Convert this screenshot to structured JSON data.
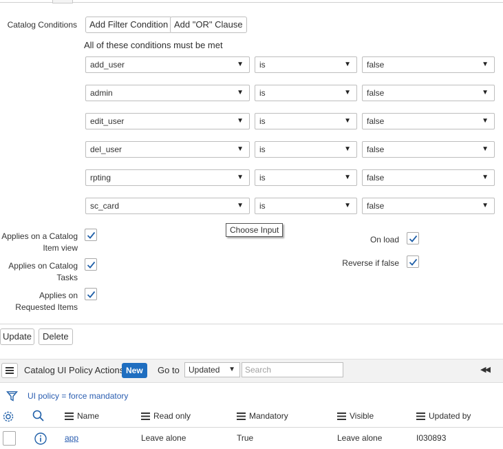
{
  "conditions": {
    "label": "Catalog Conditions",
    "add_filter": "Add Filter Condition",
    "add_or": "Add \"OR\" Clause",
    "heading": "All of these conditions must be met",
    "rows": [
      {
        "field": "add_user",
        "operator": "is",
        "value": "false"
      },
      {
        "field": "admin",
        "operator": "is",
        "value": "false"
      },
      {
        "field": "edit_user",
        "operator": "is",
        "value": "false"
      },
      {
        "field": "del_user",
        "operator": "is",
        "value": "false"
      },
      {
        "field": "rpting",
        "operator": "is",
        "value": "false"
      },
      {
        "field": "sc_card",
        "operator": "is",
        "value": "false"
      }
    ],
    "tooltip": "Choose Input"
  },
  "options": {
    "applies_catalog_item_line1": "Applies on a Catalog",
    "applies_catalog_item_line2": "Item view",
    "applies_catalog_tasks_line1": "Applies on Catalog",
    "applies_catalog_tasks_line2": "Tasks",
    "applies_requested_items_line1": "Applies on",
    "applies_requested_items_line2": "Requested Items",
    "on_load": "On load",
    "reverse_if_false": "Reverse if false",
    "checked": {
      "catalog_item": true,
      "catalog_tasks": true,
      "requested_items": true,
      "on_load": true,
      "reverse_if_false": true
    }
  },
  "actions": {
    "update": "Update",
    "delete": "Delete"
  },
  "related_list": {
    "title": "Catalog UI Policy Actions",
    "new": "New",
    "goto_label": "Go to",
    "goto_value": "Updated",
    "search_placeholder": "Search",
    "nav": "◀◀",
    "filter_text": "UI policy = force mandatory",
    "columns": [
      "Name",
      "Read only",
      "Mandatory",
      "Visible",
      "Updated by"
    ],
    "rows": [
      {
        "name": "app",
        "read_only": "Leave alone",
        "mandatory": "True",
        "visible": "Leave alone",
        "updated_by": "I030893"
      }
    ]
  },
  "colors": {
    "accent": "#1f6ec0",
    "check": "#1f5fa8",
    "link": "#2a5db0"
  }
}
